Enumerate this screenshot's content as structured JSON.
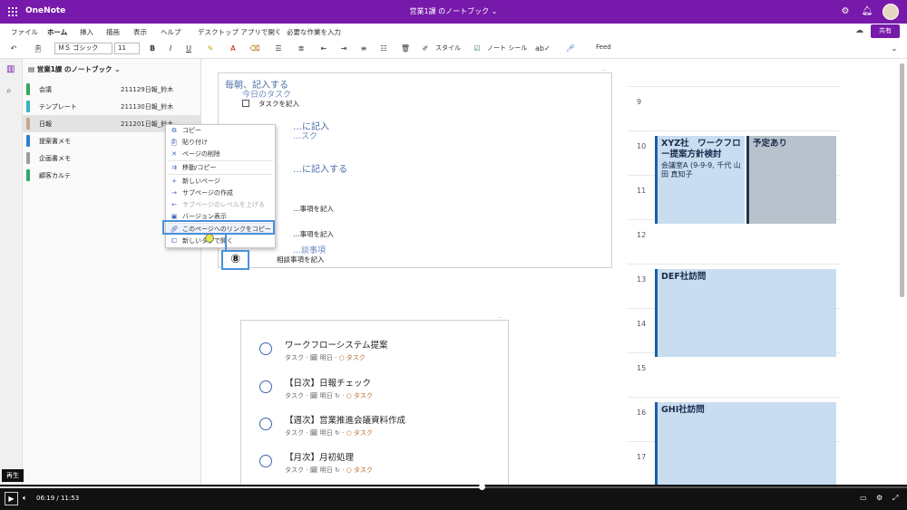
{
  "title_bar": {
    "app_name": "OneNote",
    "doc_title": "営業1課 のノートブック ⌄",
    "accent_color": "#7719aa"
  },
  "menu": {
    "items": [
      "ファイル",
      "ホーム",
      "挿入",
      "描画",
      "表示",
      "ヘルプ",
      "デスクトップ アプリで開く",
      "必要な作業を入力"
    ],
    "active": "ホーム",
    "share_label": "共有"
  },
  "ribbon": {
    "font_name": "ＭＳ ゴシック",
    "font_size": "11",
    "style_label": "スタイル",
    "note_tag_label": "ノート シール",
    "feed_label": "Feed",
    "bold": "B",
    "italic": "I",
    "underline": "U"
  },
  "notebook": {
    "name": "営業1課 のノートブック",
    "sections": [
      {
        "name": "会議",
        "page": "211129日報_鈴木",
        "color": "#37a85b"
      },
      {
        "name": "テンプレート",
        "page": "211130日報_鈴木",
        "color": "#3ab3c0"
      },
      {
        "name": "日報",
        "page": "211201日報_鈴木",
        "color": "#c6a58a",
        "selected": true
      },
      {
        "name": "提案書メモ",
        "page": "",
        "color": "#2e7fd1"
      },
      {
        "name": "企画書メモ",
        "page": "",
        "color": "#9e9e9e"
      },
      {
        "name": "顧客カルテ",
        "page": "",
        "color": "#2fa86a"
      }
    ]
  },
  "note": {
    "heading1": "毎朝、記入する",
    "sub1": "今日のタスク",
    "task1": "タスクを記入",
    "heading2": "…に記入",
    "sub2": "…スク",
    "heading3": "…に記入する",
    "task2": "…事項を記入",
    "task3": "…事項を記入",
    "sub3": "…談事項",
    "task4": "相談事項を記入"
  },
  "todo": {
    "items": [
      {
        "title": "ワークフローシステム提案",
        "meta": "タスク  · 🗓 明日  · ",
        "tag": "○ タスク"
      },
      {
        "title": "【日次】日報チェック",
        "meta": "タスク  · 🗓 明日 ↻ · ",
        "tag": "○ タスク"
      },
      {
        "title": "【週次】営業推進会議資料作成",
        "meta": "タスク  · 🗓 明日 ↻ · ",
        "tag": "○ タスク"
      },
      {
        "title": "【月次】月初処理",
        "meta": "タスク  · 🗓 明日 ↻ · ",
        "tag": "○ タスク"
      }
    ]
  },
  "calendar": {
    "hours": [
      "9",
      "10",
      "11",
      "12",
      "13",
      "14",
      "15",
      "16",
      "17"
    ],
    "events": [
      {
        "title": "XYZ社　ワークフロー提案方針検討",
        "body": "会議室A (9-9-9, 千代 山田 真知子"
      },
      {
        "title": "予定あり",
        "body": ""
      },
      {
        "title": "DEF社訪問",
        "body": ""
      },
      {
        "title": "GHI社訪問",
        "body": ""
      }
    ]
  },
  "context_menu": {
    "items": [
      {
        "label": "コピー",
        "icon": "copy-icon"
      },
      {
        "label": "貼り付け",
        "icon": "paste-icon"
      },
      {
        "label": "ページの削除",
        "icon": "delete-icon"
      },
      {
        "label": "移動/コピー",
        "icon": "move-icon"
      },
      {
        "label": "新しいページ",
        "icon": "plus-icon"
      },
      {
        "label": "サブページの作成",
        "icon": "arrow-right-icon"
      },
      {
        "label": "サブページのレベルを上げる",
        "icon": "arrow-left-icon",
        "disabled": true
      },
      {
        "label": "バージョン表示",
        "icon": "version-icon"
      },
      {
        "label": "このページへのリンクをコピー",
        "icon": "link-icon"
      },
      {
        "label": "新しいタブで開く",
        "icon": "tab-icon"
      }
    ]
  },
  "callout": {
    "label": "⑧"
  },
  "player": {
    "time": "06:19  /  11:53",
    "progress": 0.531,
    "tooltip": "再生"
  }
}
